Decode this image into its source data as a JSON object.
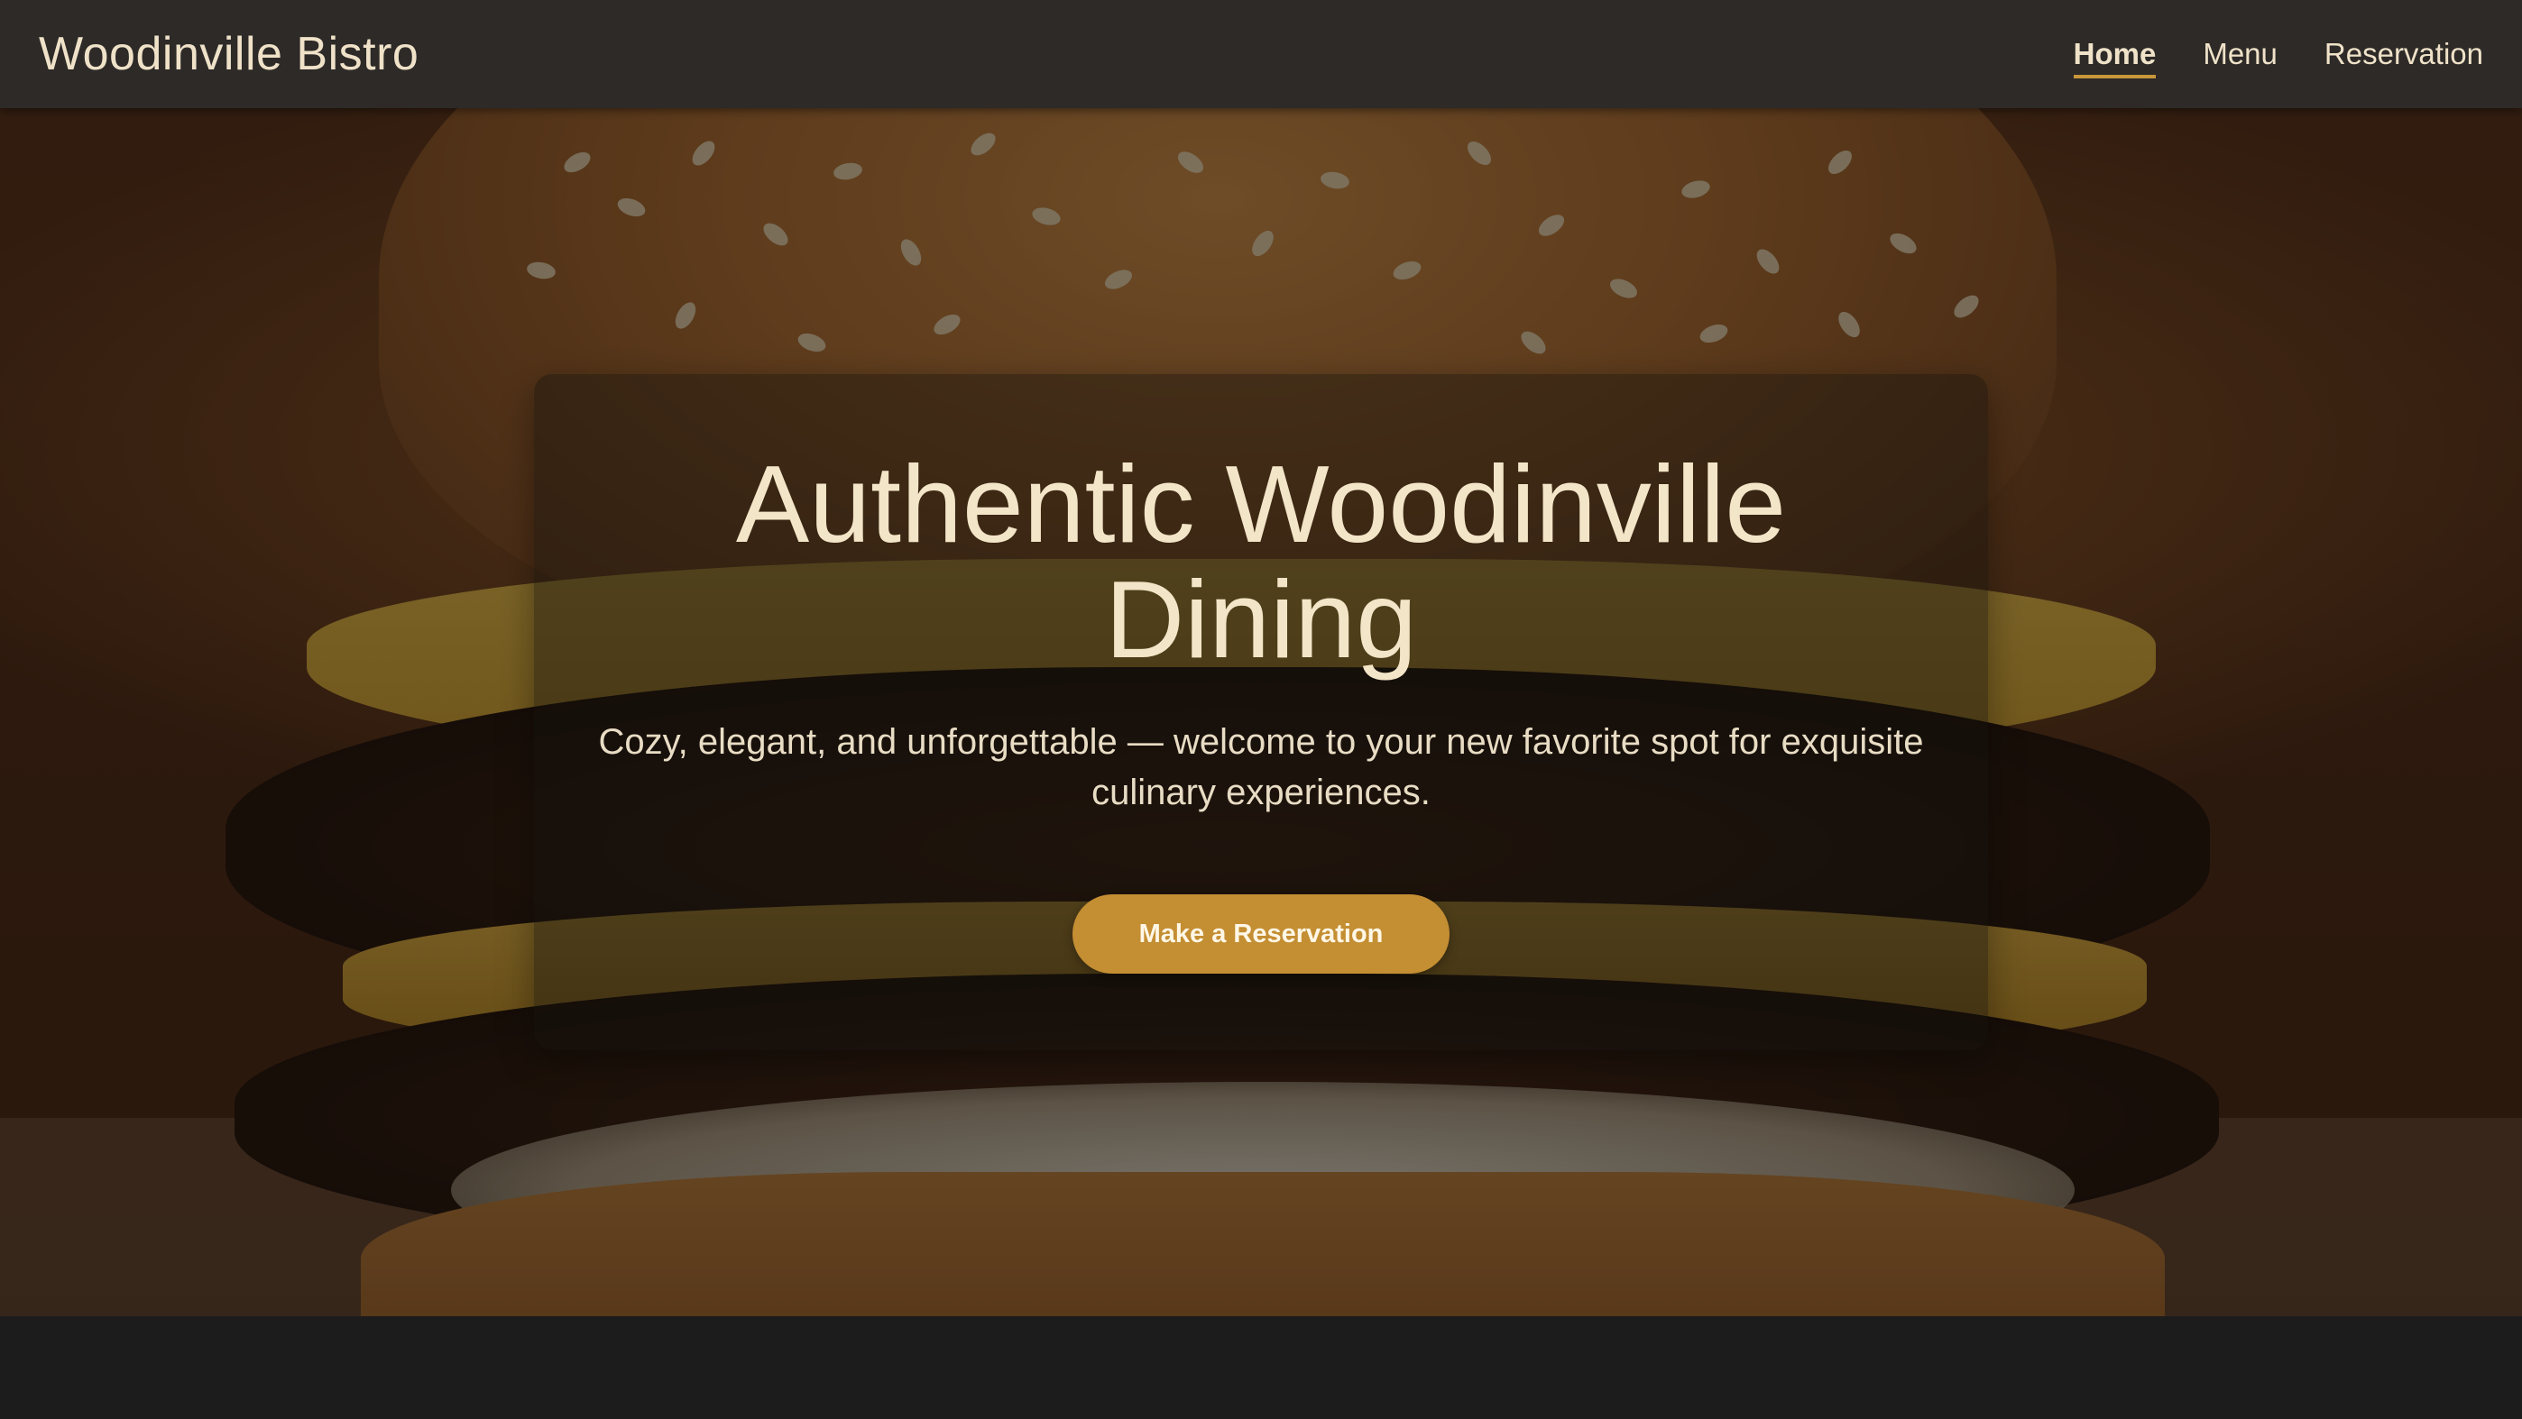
{
  "navbar": {
    "brand": "Woodinville Bistro",
    "links": [
      {
        "label": "Home",
        "active": true
      },
      {
        "label": "Menu",
        "active": false
      },
      {
        "label": "Reservation",
        "active": false
      }
    ]
  },
  "hero": {
    "background_image": "burger-photo",
    "title_line1": "Authentic Woodinville",
    "title_line2": "Dining",
    "subtitle": "Cozy, elegant, and unforgettable — welcome to your new favorite spot for exquisite culinary experiences.",
    "cta_label": "Make a Reservation"
  },
  "colors": {
    "navbar_bg": "#2d2a28",
    "text_cream": "#efe2c8",
    "accent_gold": "#c48e33",
    "footer_bg": "#1c1c1c"
  }
}
